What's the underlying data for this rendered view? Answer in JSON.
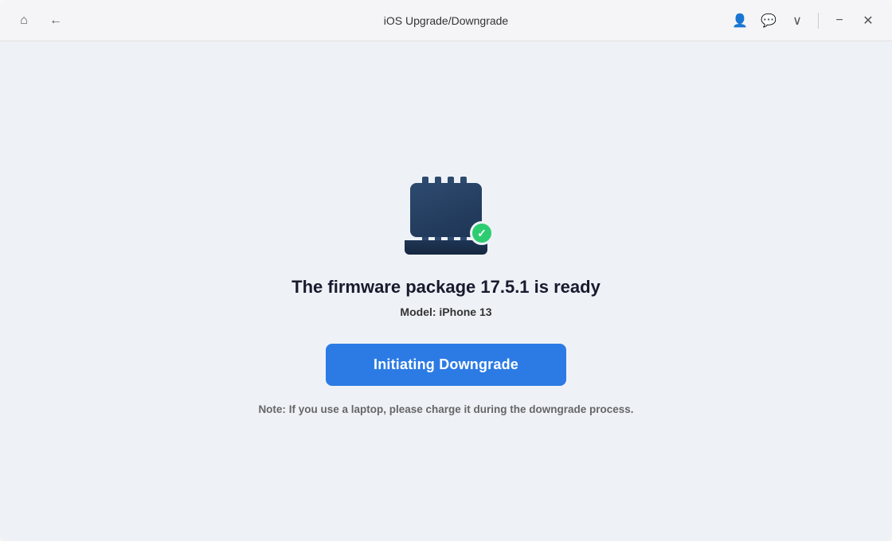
{
  "window": {
    "title": "iOS Upgrade/Downgrade"
  },
  "titlebar": {
    "home_icon": "⌂",
    "back_icon": "←",
    "account_icon": "👤",
    "chat_icon": "💬",
    "dropdown_icon": "∨",
    "minimize_icon": "−",
    "close_icon": "✕"
  },
  "main": {
    "firmware_ready_text": "The firmware package 17.5.1 is ready",
    "model_label": "Model:",
    "model_value": "iPhone 13",
    "button_label": "Initiating Downgrade",
    "note_label": "Note:",
    "note_text": "  If you use a laptop, please charge it during the downgrade process."
  },
  "illustration": {
    "check_symbol": "✓"
  }
}
